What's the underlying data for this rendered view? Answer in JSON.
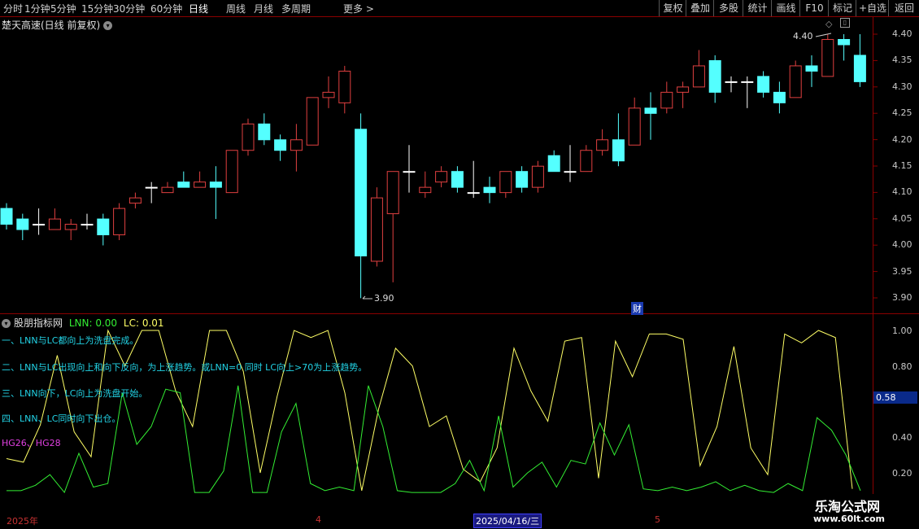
{
  "toolbar": {
    "periods": [
      "分时",
      "1分钟",
      "5分钟",
      "15分钟",
      "30分钟",
      "60分钟",
      "日线",
      "周线",
      "月线",
      "多周期",
      "更多 >"
    ],
    "active_period": "日线",
    "right_buttons": [
      "复权",
      "叠加",
      "多股",
      "统计",
      "画线",
      "F10",
      "标记",
      "+自选",
      "返回"
    ]
  },
  "stock": {
    "title": "楚天高速(日线 前复权)",
    "dropdown_icon": "chevron-down-icon"
  },
  "price_axis": [
    "4.40",
    "4.35",
    "4.30",
    "4.25",
    "4.20",
    "4.15",
    "4.10",
    "4.05",
    "4.00",
    "3.95",
    "3.90"
  ],
  "annotations": {
    "high": "4.40",
    "low": "3.90",
    "cai": "财"
  },
  "indicator": {
    "name": "股朋指标网",
    "lnn": "LNN: 0.00",
    "lc": "LC: 0.01",
    "notes": [
      "一、LNN与LC都向上为洗盘完成。",
      "二、LNN与LC出现向上和向下反向，为上涨趋势。或LNN=0 同时 LC向上>70为上涨趋势。",
      "三、LNN向下，LC向上为洗盘开始。",
      "四、LNN、LC同时向下出仓。"
    ],
    "hg": "HG26、HG28",
    "axis": [
      "1.00",
      "0.80",
      "0.58",
      "0.40",
      "0.20"
    ],
    "current_value": "0.58"
  },
  "date_axis": {
    "labels": [
      "2025年",
      "4",
      "5"
    ],
    "selected": "2025/04/16/三"
  },
  "watermark": {
    "line1": "乐淘公式网",
    "line2": "www.60lt.com"
  },
  "colors": {
    "up": "#e04040",
    "down": "#54ffff",
    "yellow": "#ffff66",
    "green": "#33ee33",
    "frame": "#8b0000"
  },
  "chart_data": [
    {
      "type": "candlestick",
      "title": "楚天高速(日线 前复权)",
      "ylim": [
        3.88,
        4.43
      ],
      "candles": [
        {
          "o": 4.07,
          "c": 4.04,
          "h": 4.08,
          "l": 4.03
        },
        {
          "o": 4.05,
          "c": 4.03,
          "h": 4.06,
          "l": 4.01
        },
        {
          "o": 4.04,
          "c": 4.04,
          "h": 4.07,
          "l": 4.02
        },
        {
          "o": 4.03,
          "c": 4.05,
          "h": 4.07,
          "l": 4.03
        },
        {
          "o": 4.03,
          "c": 4.04,
          "h": 4.05,
          "l": 4.01
        },
        {
          "o": 4.04,
          "c": 4.04,
          "h": 4.06,
          "l": 4.03
        },
        {
          "o": 4.05,
          "c": 4.02,
          "h": 4.06,
          "l": 4.0
        },
        {
          "o": 4.02,
          "c": 4.07,
          "h": 4.08,
          "l": 4.01
        },
        {
          "o": 4.08,
          "c": 4.09,
          "h": 4.1,
          "l": 4.07
        },
        {
          "o": 4.11,
          "c": 4.11,
          "h": 4.12,
          "l": 4.08
        },
        {
          "o": 4.1,
          "c": 4.11,
          "h": 4.12,
          "l": 4.1
        },
        {
          "o": 4.12,
          "c": 4.11,
          "h": 4.14,
          "l": 4.11
        },
        {
          "o": 4.11,
          "c": 4.12,
          "h": 4.14,
          "l": 4.11
        },
        {
          "o": 4.12,
          "c": 4.11,
          "h": 4.15,
          "l": 4.05
        },
        {
          "o": 4.1,
          "c": 4.18,
          "h": 4.18,
          "l": 4.1
        },
        {
          "o": 4.18,
          "c": 4.23,
          "h": 4.24,
          "l": 4.17
        },
        {
          "o": 4.23,
          "c": 4.2,
          "h": 4.25,
          "l": 4.19
        },
        {
          "o": 4.2,
          "c": 4.18,
          "h": 4.21,
          "l": 4.16
        },
        {
          "o": 4.18,
          "c": 4.2,
          "h": 4.23,
          "l": 4.14
        },
        {
          "o": 4.19,
          "c": 4.28,
          "h": 4.28,
          "l": 4.19
        },
        {
          "o": 4.28,
          "c": 4.29,
          "h": 4.32,
          "l": 4.26
        },
        {
          "o": 4.27,
          "c": 4.33,
          "h": 4.34,
          "l": 4.25
        },
        {
          "o": 4.22,
          "c": 3.98,
          "h": 4.25,
          "l": 3.9
        },
        {
          "o": 3.97,
          "c": 4.09,
          "h": 4.11,
          "l": 3.96
        },
        {
          "o": 4.06,
          "c": 4.14,
          "h": 4.14,
          "l": 3.93
        },
        {
          "o": 4.14,
          "c": 4.14,
          "h": 4.19,
          "l": 4.1
        },
        {
          "o": 4.1,
          "c": 4.11,
          "h": 4.14,
          "l": 4.09
        },
        {
          "o": 4.12,
          "c": 4.14,
          "h": 4.15,
          "l": 4.11
        },
        {
          "o": 4.14,
          "c": 4.11,
          "h": 4.15,
          "l": 4.1
        },
        {
          "o": 4.1,
          "c": 4.1,
          "h": 4.16,
          "l": 4.09
        },
        {
          "o": 4.11,
          "c": 4.1,
          "h": 4.13,
          "l": 4.08
        },
        {
          "o": 4.1,
          "c": 4.14,
          "h": 4.14,
          "l": 4.09
        },
        {
          "o": 4.14,
          "c": 4.11,
          "h": 4.15,
          "l": 4.1
        },
        {
          "o": 4.11,
          "c": 4.15,
          "h": 4.16,
          "l": 4.1
        },
        {
          "o": 4.17,
          "c": 4.14,
          "h": 4.18,
          "l": 4.14
        },
        {
          "o": 4.14,
          "c": 4.14,
          "h": 4.19,
          "l": 4.12
        },
        {
          "o": 4.14,
          "c": 4.18,
          "h": 4.19,
          "l": 4.14
        },
        {
          "o": 4.18,
          "c": 4.2,
          "h": 4.22,
          "l": 4.17
        },
        {
          "o": 4.2,
          "c": 4.16,
          "h": 4.25,
          "l": 4.15
        },
        {
          "o": 4.19,
          "c": 4.26,
          "h": 4.28,
          "l": 4.19
        },
        {
          "o": 4.26,
          "c": 4.25,
          "h": 4.29,
          "l": 4.2
        },
        {
          "o": 4.26,
          "c": 4.29,
          "h": 4.31,
          "l": 4.25
        },
        {
          "o": 4.29,
          "c": 4.3,
          "h": 4.31,
          "l": 4.26
        },
        {
          "o": 4.3,
          "c": 4.34,
          "h": 4.37,
          "l": 4.3
        },
        {
          "o": 4.35,
          "c": 4.29,
          "h": 4.36,
          "l": 4.27
        },
        {
          "o": 4.31,
          "c": 4.31,
          "h": 4.32,
          "l": 4.29
        },
        {
          "o": 4.31,
          "c": 4.31,
          "h": 4.32,
          "l": 4.26
        },
        {
          "o": 4.32,
          "c": 4.29,
          "h": 4.33,
          "l": 4.28
        },
        {
          "o": 4.29,
          "c": 4.27,
          "h": 4.31,
          "l": 4.25
        },
        {
          "o": 4.28,
          "c": 4.34,
          "h": 4.35,
          "l": 4.28
        },
        {
          "o": 4.34,
          "c": 4.33,
          "h": 4.36,
          "l": 4.3
        },
        {
          "o": 4.32,
          "c": 4.39,
          "h": 4.4,
          "l": 4.32
        },
        {
          "o": 4.39,
          "c": 4.38,
          "h": 4.4,
          "l": 4.35
        },
        {
          "o": 4.36,
          "c": 4.31,
          "h": 4.4,
          "l": 4.3
        }
      ]
    },
    {
      "type": "line",
      "ylim": [
        0.09,
        1.04
      ],
      "series": [
        {
          "name": "LNN",
          "color": "#ffff66",
          "values": [
            0.28,
            0.26,
            0.47,
            0.86,
            0.43,
            0.29,
            1.0,
            0.8,
            1.0,
            1.0,
            0.66,
            0.46,
            1.0,
            1.0,
            0.77,
            0.2,
            0.63,
            1.0,
            0.96,
            1.0,
            0.65,
            0.1,
            0.56,
            0.9,
            0.8,
            0.46,
            0.52,
            0.22,
            0.15,
            0.34,
            0.9,
            0.66,
            0.49,
            0.94,
            0.96,
            0.17,
            0.94,
            0.74,
            0.98,
            0.98,
            0.95,
            0.24,
            0.46,
            0.91,
            0.34,
            0.19,
            0.98,
            0.93,
            1.0,
            0.96,
            0.11
          ]
        },
        {
          "name": "LC",
          "color": "#33ee33",
          "values": [
            0.1,
            0.1,
            0.13,
            0.19,
            0.09,
            0.31,
            0.12,
            0.14,
            0.65,
            0.36,
            0.46,
            0.67,
            0.65,
            0.09,
            0.09,
            0.21,
            0.69,
            0.09,
            0.09,
            0.43,
            0.59,
            0.14,
            0.1,
            0.12,
            0.1,
            0.69,
            0.46,
            0.1,
            0.09,
            0.09,
            0.09,
            0.14,
            0.27,
            0.1,
            0.52,
            0.12,
            0.2,
            0.26,
            0.12,
            0.27,
            0.25,
            0.48,
            0.3,
            0.47,
            0.11,
            0.1,
            0.12,
            0.1,
            0.12,
            0.15,
            0.1,
            0.13,
            0.1,
            0.09,
            0.14,
            0.1,
            0.51,
            0.44,
            0.3,
            0.1
          ]
        }
      ]
    }
  ]
}
